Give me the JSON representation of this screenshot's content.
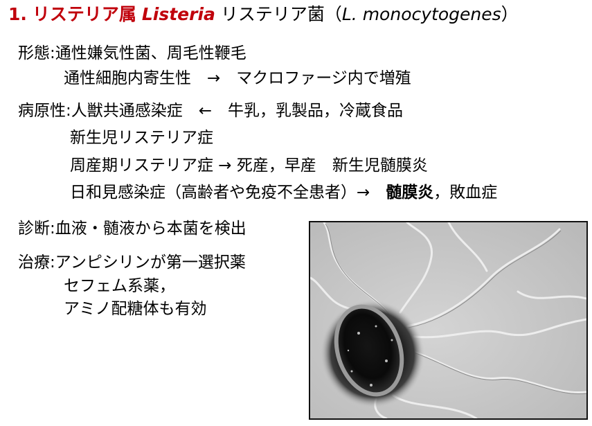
{
  "title": {
    "number": "1.",
    "genus_jp": "リステリア属",
    "genus_latin": "Listeria",
    "species_jp": "リステリア菌",
    "paren_open": "（",
    "species_latin": "L. monocytogenes",
    "paren_close": "）"
  },
  "morphology": {
    "line1": "形態:通性嫌気性菌、周毛性鞭毛",
    "line2": "通性細胞内寄生性　→　マクロファージ内で増殖"
  },
  "pathogenicity": {
    "line1": "病原性:人獣共通感染症　←　牛乳，乳製品，冷蔵食品",
    "line2": "新生児リステリア症",
    "line3": "周産期リステリア症 → 死産，早産　新生児髄膜炎",
    "line4_prefix": "日和見感染症（高齢者や免疫不全患者）→　",
    "line4_bold": "髄膜炎",
    "line4_suffix": "，敗血症"
  },
  "diagnosis": {
    "line1": "診断:血液・髄液から本菌を検出"
  },
  "treatment": {
    "line1": "治療:アンピシリンが第一選択薬",
    "line2": "セフェム系薬，",
    "line3": "アミノ配糖体も有効"
  },
  "colors": {
    "title_red": "#c0000b",
    "text": "#000000",
    "micrograph_bg": "#c9c9c9"
  }
}
